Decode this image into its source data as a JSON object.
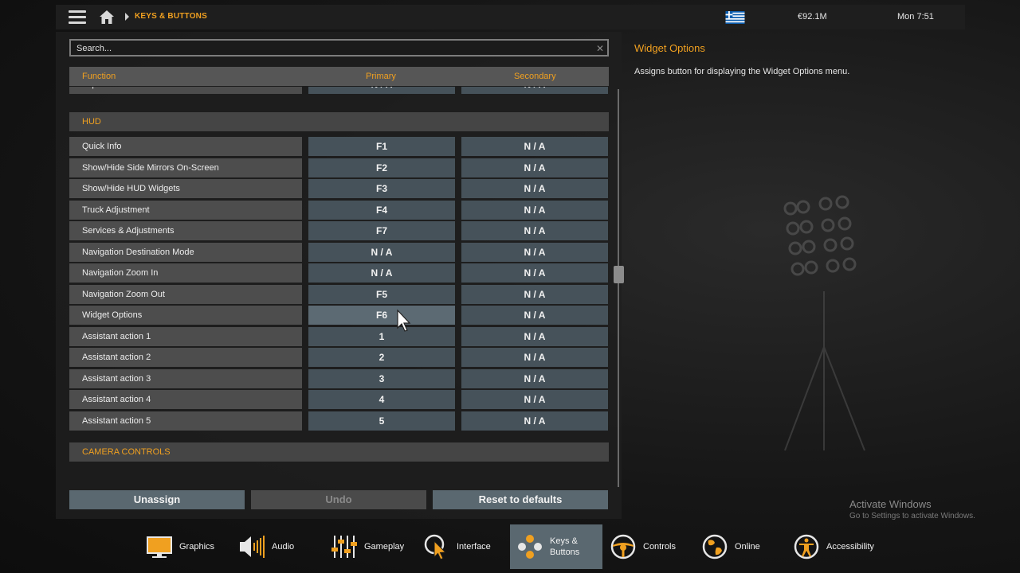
{
  "topbar": {
    "breadcrumb": "KEYS & BUTTONS",
    "money": "€92.1M",
    "clock": "Mon 7:51",
    "flag_colors": [
      "#0d5eaf",
      "#ffffff"
    ]
  },
  "search": {
    "placeholder": "Search..."
  },
  "columns": {
    "function": "Function",
    "primary": "Primary",
    "secondary": "Secondary"
  },
  "partial_row": {
    "function": "Trip Info Reset",
    "primary": "N / A",
    "secondary": "N / A"
  },
  "sections": [
    {
      "title": "HUD",
      "rows": [
        {
          "function": "Quick Info",
          "primary": "F1",
          "secondary": "N / A"
        },
        {
          "function": "Show/Hide Side Mirrors On-Screen",
          "primary": "F2",
          "secondary": "N / A"
        },
        {
          "function": "Show/Hide HUD Widgets",
          "primary": "F3",
          "secondary": "N / A"
        },
        {
          "function": "Truck Adjustment",
          "primary": "F4",
          "secondary": "N / A"
        },
        {
          "function": "Services & Adjustments",
          "primary": "F7",
          "secondary": "N / A"
        },
        {
          "function": "Navigation Destination Mode",
          "primary": "N / A",
          "secondary": "N / A"
        },
        {
          "function": "Navigation Zoom In",
          "primary": "N / A",
          "secondary": "N / A"
        },
        {
          "function": "Navigation Zoom Out",
          "primary": "F5",
          "secondary": "N / A"
        },
        {
          "function": "Widget Options",
          "primary": "F6",
          "secondary": "N / A"
        },
        {
          "function": "Assistant action 1",
          "primary": "1",
          "secondary": "N / A"
        },
        {
          "function": "Assistant action 2",
          "primary": "2",
          "secondary": "N / A"
        },
        {
          "function": "Assistant action 3",
          "primary": "3",
          "secondary": "N / A"
        },
        {
          "function": "Assistant action 4",
          "primary": "4",
          "secondary": "N / A"
        },
        {
          "function": "Assistant action 5",
          "primary": "5",
          "secondary": "N / A"
        }
      ]
    },
    {
      "title": "CAMERA CONTROLS",
      "rows": []
    }
  ],
  "buttons": {
    "unassign": "Unassign",
    "undo": "Undo",
    "reset": "Reset to defaults"
  },
  "detail": {
    "title": "Widget Options",
    "description": "Assigns button for displaying the Widget Options menu."
  },
  "watermark": {
    "line1": "Activate Windows",
    "line2": "Go to Settings to activate Windows."
  },
  "tabs": [
    {
      "icon": "monitor-icon",
      "label": "Graphics"
    },
    {
      "icon": "speaker-icon",
      "label": "Audio"
    },
    {
      "icon": "sliders-icon",
      "label": "Gameplay"
    },
    {
      "icon": "cursor-icon",
      "label": "Interface"
    },
    {
      "icon": "keys-icon",
      "label": "Keys &",
      "label2": "Buttons",
      "active": true
    },
    {
      "icon": "steering-wheel-icon",
      "label": "Controls"
    },
    {
      "icon": "globe-icon",
      "label": "Online"
    },
    {
      "icon": "accessibility-icon",
      "label": "Accessibility"
    }
  ],
  "colors": {
    "accent": "#f0a020",
    "key_cell": "#46525a",
    "active_tab": "#5a6870"
  }
}
